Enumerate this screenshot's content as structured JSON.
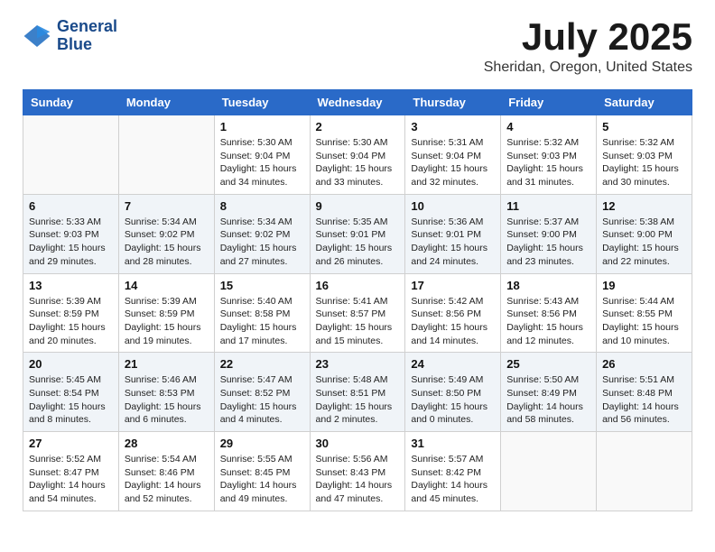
{
  "header": {
    "logo_line1": "General",
    "logo_line2": "Blue",
    "month_year": "July 2025",
    "location": "Sheridan, Oregon, United States"
  },
  "days_of_week": [
    "Sunday",
    "Monday",
    "Tuesday",
    "Wednesday",
    "Thursday",
    "Friday",
    "Saturday"
  ],
  "weeks": [
    [
      {
        "day": "",
        "info": ""
      },
      {
        "day": "",
        "info": ""
      },
      {
        "day": "1",
        "info": "Sunrise: 5:30 AM\nSunset: 9:04 PM\nDaylight: 15 hours\nand 34 minutes."
      },
      {
        "day": "2",
        "info": "Sunrise: 5:30 AM\nSunset: 9:04 PM\nDaylight: 15 hours\nand 33 minutes."
      },
      {
        "day": "3",
        "info": "Sunrise: 5:31 AM\nSunset: 9:04 PM\nDaylight: 15 hours\nand 32 minutes."
      },
      {
        "day": "4",
        "info": "Sunrise: 5:32 AM\nSunset: 9:03 PM\nDaylight: 15 hours\nand 31 minutes."
      },
      {
        "day": "5",
        "info": "Sunrise: 5:32 AM\nSunset: 9:03 PM\nDaylight: 15 hours\nand 30 minutes."
      }
    ],
    [
      {
        "day": "6",
        "info": "Sunrise: 5:33 AM\nSunset: 9:03 PM\nDaylight: 15 hours\nand 29 minutes."
      },
      {
        "day": "7",
        "info": "Sunrise: 5:34 AM\nSunset: 9:02 PM\nDaylight: 15 hours\nand 28 minutes."
      },
      {
        "day": "8",
        "info": "Sunrise: 5:34 AM\nSunset: 9:02 PM\nDaylight: 15 hours\nand 27 minutes."
      },
      {
        "day": "9",
        "info": "Sunrise: 5:35 AM\nSunset: 9:01 PM\nDaylight: 15 hours\nand 26 minutes."
      },
      {
        "day": "10",
        "info": "Sunrise: 5:36 AM\nSunset: 9:01 PM\nDaylight: 15 hours\nand 24 minutes."
      },
      {
        "day": "11",
        "info": "Sunrise: 5:37 AM\nSunset: 9:00 PM\nDaylight: 15 hours\nand 23 minutes."
      },
      {
        "day": "12",
        "info": "Sunrise: 5:38 AM\nSunset: 9:00 PM\nDaylight: 15 hours\nand 22 minutes."
      }
    ],
    [
      {
        "day": "13",
        "info": "Sunrise: 5:39 AM\nSunset: 8:59 PM\nDaylight: 15 hours\nand 20 minutes."
      },
      {
        "day": "14",
        "info": "Sunrise: 5:39 AM\nSunset: 8:59 PM\nDaylight: 15 hours\nand 19 minutes."
      },
      {
        "day": "15",
        "info": "Sunrise: 5:40 AM\nSunset: 8:58 PM\nDaylight: 15 hours\nand 17 minutes."
      },
      {
        "day": "16",
        "info": "Sunrise: 5:41 AM\nSunset: 8:57 PM\nDaylight: 15 hours\nand 15 minutes."
      },
      {
        "day": "17",
        "info": "Sunrise: 5:42 AM\nSunset: 8:56 PM\nDaylight: 15 hours\nand 14 minutes."
      },
      {
        "day": "18",
        "info": "Sunrise: 5:43 AM\nSunset: 8:56 PM\nDaylight: 15 hours\nand 12 minutes."
      },
      {
        "day": "19",
        "info": "Sunrise: 5:44 AM\nSunset: 8:55 PM\nDaylight: 15 hours\nand 10 minutes."
      }
    ],
    [
      {
        "day": "20",
        "info": "Sunrise: 5:45 AM\nSunset: 8:54 PM\nDaylight: 15 hours\nand 8 minutes."
      },
      {
        "day": "21",
        "info": "Sunrise: 5:46 AM\nSunset: 8:53 PM\nDaylight: 15 hours\nand 6 minutes."
      },
      {
        "day": "22",
        "info": "Sunrise: 5:47 AM\nSunset: 8:52 PM\nDaylight: 15 hours\nand 4 minutes."
      },
      {
        "day": "23",
        "info": "Sunrise: 5:48 AM\nSunset: 8:51 PM\nDaylight: 15 hours\nand 2 minutes."
      },
      {
        "day": "24",
        "info": "Sunrise: 5:49 AM\nSunset: 8:50 PM\nDaylight: 15 hours\nand 0 minutes."
      },
      {
        "day": "25",
        "info": "Sunrise: 5:50 AM\nSunset: 8:49 PM\nDaylight: 14 hours\nand 58 minutes."
      },
      {
        "day": "26",
        "info": "Sunrise: 5:51 AM\nSunset: 8:48 PM\nDaylight: 14 hours\nand 56 minutes."
      }
    ],
    [
      {
        "day": "27",
        "info": "Sunrise: 5:52 AM\nSunset: 8:47 PM\nDaylight: 14 hours\nand 54 minutes."
      },
      {
        "day": "28",
        "info": "Sunrise: 5:54 AM\nSunset: 8:46 PM\nDaylight: 14 hours\nand 52 minutes."
      },
      {
        "day": "29",
        "info": "Sunrise: 5:55 AM\nSunset: 8:45 PM\nDaylight: 14 hours\nand 49 minutes."
      },
      {
        "day": "30",
        "info": "Sunrise: 5:56 AM\nSunset: 8:43 PM\nDaylight: 14 hours\nand 47 minutes."
      },
      {
        "day": "31",
        "info": "Sunrise: 5:57 AM\nSunset: 8:42 PM\nDaylight: 14 hours\nand 45 minutes."
      },
      {
        "day": "",
        "info": ""
      },
      {
        "day": "",
        "info": ""
      }
    ]
  ]
}
